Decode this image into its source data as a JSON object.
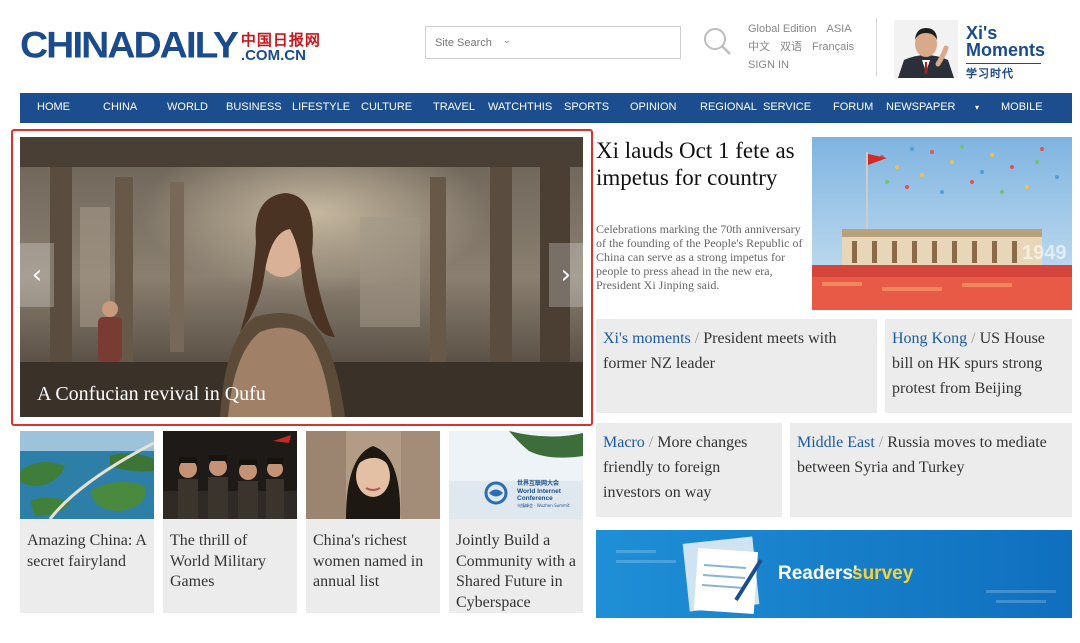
{
  "header": {
    "logo_main": "CHINADAILY",
    "logo_cn": "中国日报网",
    "logo_com": ".COM.CN",
    "search_placeholder": "Site Search",
    "editions": {
      "global": "Global Edition",
      "asia": "ASIA",
      "zh": "中文",
      "bilingual": "双语",
      "fr": "Français",
      "signin": "SIGN IN"
    },
    "xi_moments_title_1": "Xi's",
    "xi_moments_title_2": "Moments",
    "xi_moments_cn": "学习时代"
  },
  "nav": {
    "items": [
      "HOME",
      "CHINA",
      "WORLD",
      "BUSINESS",
      "LIFESTYLE",
      "CULTURE",
      "TRAVEL",
      "WATCHTHIS",
      "SPORTS",
      "OPINION",
      "REGIONAL",
      "SERVICE",
      "FORUM",
      "NEWSPAPER",
      "▾",
      "MOBILE"
    ]
  },
  "slider": {
    "caption": "A Confucian revival in Qufu",
    "prev": "‹",
    "next": "›"
  },
  "lead": {
    "title": "Xi lauds Oct 1 fete as impetus for country",
    "summary": "Celebrations marking the 70th anniversary of the founding of the People's Republic of China can serve as a strong impetus for people to press ahead in the new era, President Xi Jinping said.",
    "image_year": "1949"
  },
  "boxes": [
    {
      "tag": "Xi's moments",
      "sep": " / ",
      "text": "President meets with former NZ leader"
    },
    {
      "tag": "Hong Kong",
      "sep": " / ",
      "text": "US House bill on HK spurs strong protest from Beijing"
    },
    {
      "tag": "Macro",
      "sep": " / ",
      "text": "More changes friendly to foreign investors on way"
    },
    {
      "tag": "Middle East",
      "sep": " / ",
      "text": "Russia moves to mediate between Syria and Turkey"
    }
  ],
  "thumbs": [
    {
      "caption": "Amazing China: A secret fairyland"
    },
    {
      "caption": "The thrill of World Military Games"
    },
    {
      "caption": "China's richest women named in annual list"
    },
    {
      "caption": "Jointly Build a Community with a Shared Future in Cyberspace",
      "image_text_cn": "世界互联网大会",
      "image_text_en_1": "World Internet",
      "image_text_en_2": "Conference",
      "image_text_summit": "乌镇峰会 · Wuzhen Summit"
    }
  ],
  "survey": {
    "text_1": "Readers'",
    "text_2": "survey"
  }
}
